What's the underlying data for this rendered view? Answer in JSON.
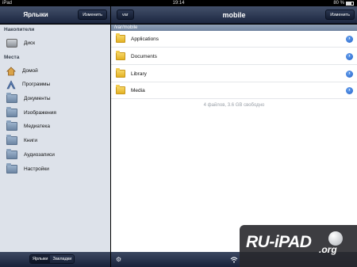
{
  "status": {
    "carrier": "iPad",
    "time": "19:14",
    "battery": "80 %"
  },
  "sidebar": {
    "title": "Ярлыки",
    "edit_label": "Изменить",
    "section_drives": "Накопители",
    "drives": [
      {
        "label": "Диск",
        "icon": "disk-icon"
      }
    ],
    "section_places": "Места",
    "places": [
      {
        "label": "Домой",
        "icon": "home-icon"
      },
      {
        "label": "Программы",
        "icon": "applications-icon"
      },
      {
        "label": "Документы",
        "icon": "folder-icon"
      },
      {
        "label": "Изображения",
        "icon": "folder-icon"
      },
      {
        "label": "Медиатека",
        "icon": "folder-icon"
      },
      {
        "label": "Книги",
        "icon": "folder-icon"
      },
      {
        "label": "Аудиозаписи",
        "icon": "folder-icon"
      },
      {
        "label": "Настройки",
        "icon": "folder-icon"
      }
    ],
    "tabs": {
      "active": "Ярлыки",
      "inactive": "Закладки"
    }
  },
  "main": {
    "title": "mobile",
    "back_label": "var",
    "edit_label": "Изменить",
    "path": "/var/mobile",
    "files": [
      {
        "name": "Applications"
      },
      {
        "name": "Documents"
      },
      {
        "name": "Library"
      },
      {
        "name": "Media"
      }
    ],
    "summary": "4 файлов, 3.6 GB свободно"
  },
  "watermark": {
    "text": "RU-iPAD",
    "suffix": ".org"
  },
  "colors": {
    "navbar": "#2a3650",
    "sidebar_bg": "#dde2ea",
    "folder": "#f2cc4e",
    "disclosure": "#2f6fd6"
  }
}
